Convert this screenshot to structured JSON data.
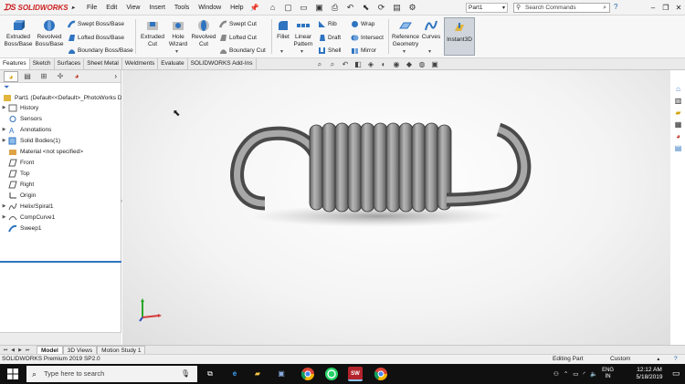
{
  "app": {
    "brand": "SOLIDWORKS",
    "menu": [
      "File",
      "Edit",
      "View",
      "Insert",
      "Tools",
      "Window",
      "Help"
    ],
    "document_name": "Part1",
    "search_placeholder": "Search Commands"
  },
  "ribbon": {
    "extruded_boss": "Extruded Boss/Base",
    "revolved_boss": "Revolved Boss/Base",
    "swept_boss": "Swept Boss/Base",
    "lofted_boss": "Lofted Boss/Base",
    "boundary_boss": "Boundary Boss/Base",
    "extruded_cut": "Extruded Cut",
    "hole_wizard": "Hole Wizard",
    "revolved_cut": "Revolved Cut",
    "swept_cut": "Swept Cut",
    "lofted_cut": "Lofted Cut",
    "boundary_cut": "Boundary Cut",
    "fillet": "Fillet",
    "linear_pattern": "Linear Pattern",
    "rib": "Rib",
    "draft": "Draft",
    "shell": "Shell",
    "wrap": "Wrap",
    "intersect": "Intersect",
    "mirror": "Mirror",
    "reference_geometry": "Reference Geometry",
    "curves": "Curves",
    "instant3d": "Instant3D"
  },
  "command_tabs": [
    "Features",
    "Sketch",
    "Surfaces",
    "Sheet Metal",
    "Weldments",
    "Evaluate",
    "SOLIDWORKS Add-Ins"
  ],
  "active_command_tab": "Features",
  "feature_tree": {
    "root": "Part1  (Default<<Default>_PhotoWorks D",
    "items": [
      {
        "label": "History",
        "icon": "history-icon",
        "expandable": true
      },
      {
        "label": "Sensors",
        "icon": "sensor-icon",
        "expandable": false
      },
      {
        "label": "Annotations",
        "icon": "annotation-icon",
        "expandable": true
      },
      {
        "label": "Solid Bodies(1)",
        "icon": "solid-bodies-icon",
        "expandable": true
      },
      {
        "label": "Material <not specified>",
        "icon": "material-icon",
        "expandable": false
      },
      {
        "label": "Front",
        "icon": "plane-icon",
        "expandable": false
      },
      {
        "label": "Top",
        "icon": "plane-icon",
        "expandable": false
      },
      {
        "label": "Right",
        "icon": "plane-icon",
        "expandable": false
      },
      {
        "label": "Origin",
        "icon": "origin-icon",
        "expandable": false
      },
      {
        "label": "Helix/Spiral1",
        "icon": "helix-icon",
        "expandable": true
      },
      {
        "label": "CompCurve1",
        "icon": "curve-icon",
        "expandable": true
      },
      {
        "label": "Sweep1",
        "icon": "sweep-icon",
        "expandable": false
      }
    ]
  },
  "model_tabs": [
    "Model",
    "3D Views",
    "Motion Study 1"
  ],
  "active_model_tab": "Model",
  "status": {
    "version": "SOLIDWORKS Premium 2019 SP2.0",
    "mode": "Editing Part",
    "units": "Custom"
  },
  "taskbar": {
    "search_placeholder": "Type here to search",
    "language": "ENG",
    "region": "IN",
    "time": "12:12 AM",
    "date": "5/18/2019"
  },
  "colors": {
    "accent": "#2f74c0",
    "brand_red": "#cc1f1f",
    "spring_grey": "#8c8c8c",
    "taskbar": "#101010"
  }
}
